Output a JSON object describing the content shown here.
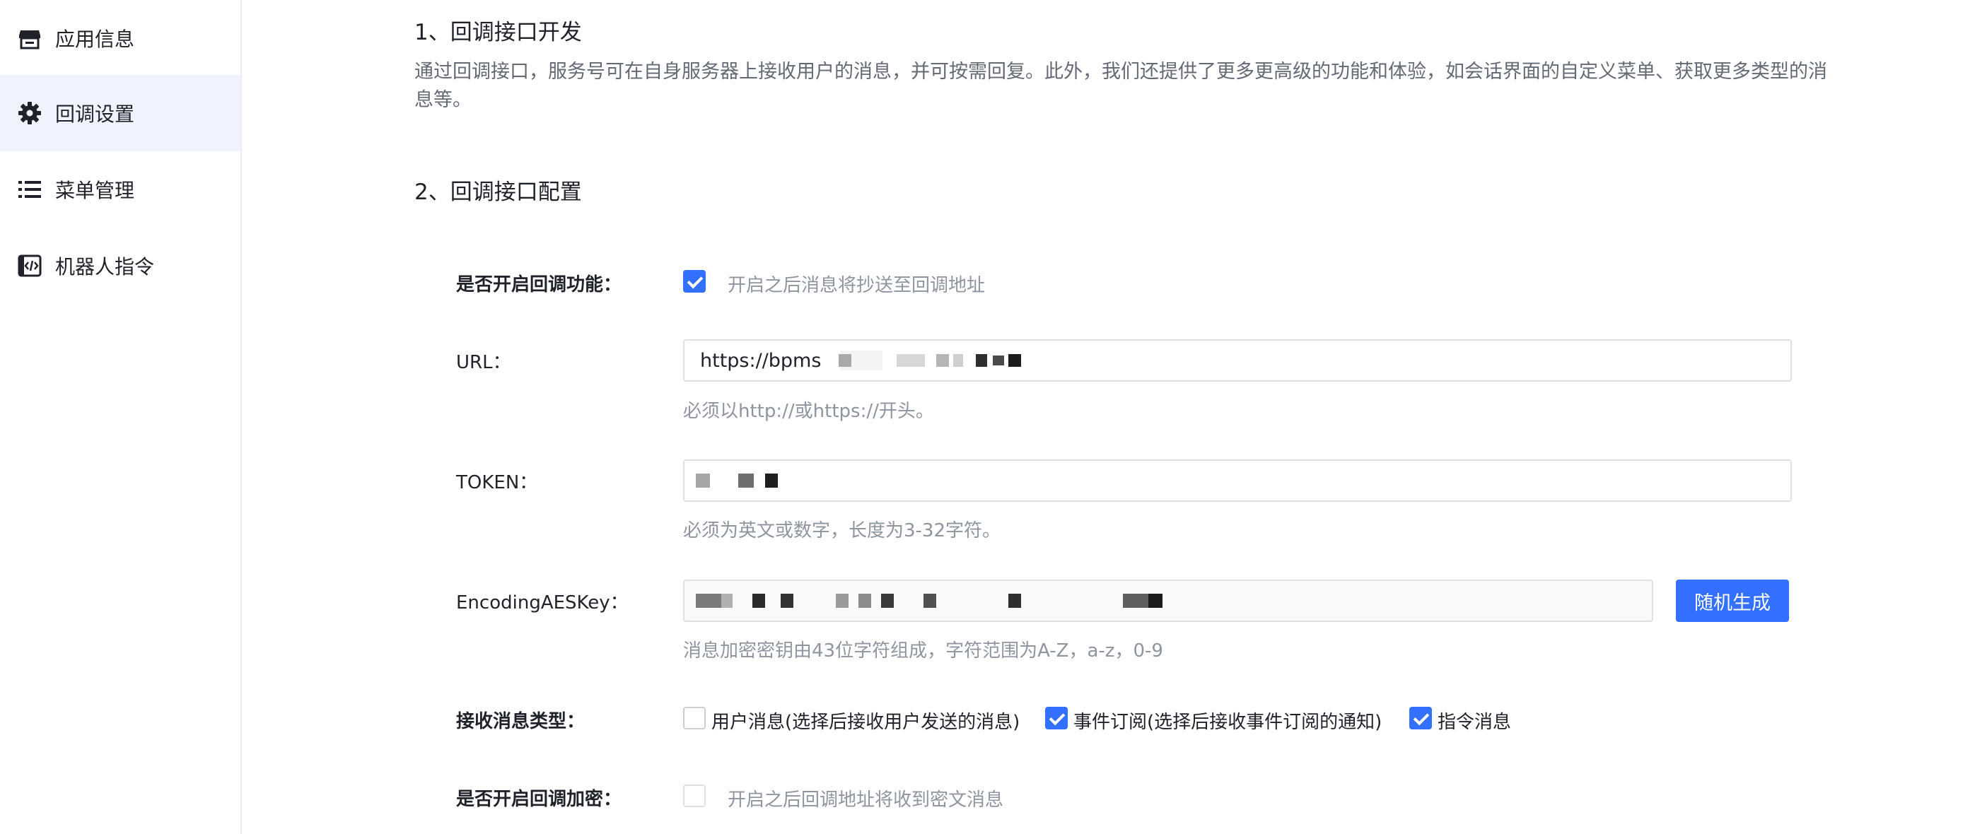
{
  "sidebar": {
    "items": [
      {
        "label": "应用信息",
        "icon": "store-icon",
        "active": false
      },
      {
        "label": "回调设置",
        "icon": "gear-icon",
        "active": true
      },
      {
        "label": "菜单管理",
        "icon": "list-icon",
        "active": false
      },
      {
        "label": "机器人指令",
        "icon": "code-icon",
        "active": false
      }
    ]
  },
  "section1": {
    "title": "1、回调接口开发",
    "description": "通过回调接口，服务号可在自身服务器上接收用户的消息，并可按需回复。此外，我们还提供了更多更高级的功能和体验，如会话界面的自定义菜单、获取更多类型的消息等。"
  },
  "section2": {
    "title": "2、回调接口配置"
  },
  "form": {
    "enable_callback": {
      "label": "是否开启回调功能：",
      "checked": true,
      "hint": "开启之后消息将抄送至回调地址"
    },
    "url": {
      "label": "URL：",
      "value": "https://bpms",
      "hint": "必须以http://或https://开头。"
    },
    "token": {
      "label": "TOKEN：",
      "value": "",
      "hint": "必须为英文或数字，长度为3-32字符。"
    },
    "aes_key": {
      "label": "EncodingAESKey：",
      "value": "",
      "button": "随机生成",
      "hint": "消息加密密钥由43位字符组成，字符范围为A-Z，a-z，0-9"
    },
    "message_types": {
      "label": "接收消息类型：",
      "options": [
        {
          "label": "用户消息(选择后接收用户发送的消息)",
          "checked": false
        },
        {
          "label": "事件订阅(选择后接收事件订阅的通知)",
          "checked": true
        },
        {
          "label": "指令消息",
          "checked": true
        }
      ]
    },
    "encryption": {
      "label": "是否开启回调加密：",
      "checked": false,
      "hint": "开启之后回调地址将收到密文消息"
    }
  },
  "colors": {
    "accent": "#3370ff",
    "active_nav_bg": "#eef3fd",
    "hint_text": "#8f959e",
    "border": "#dee0e3"
  }
}
